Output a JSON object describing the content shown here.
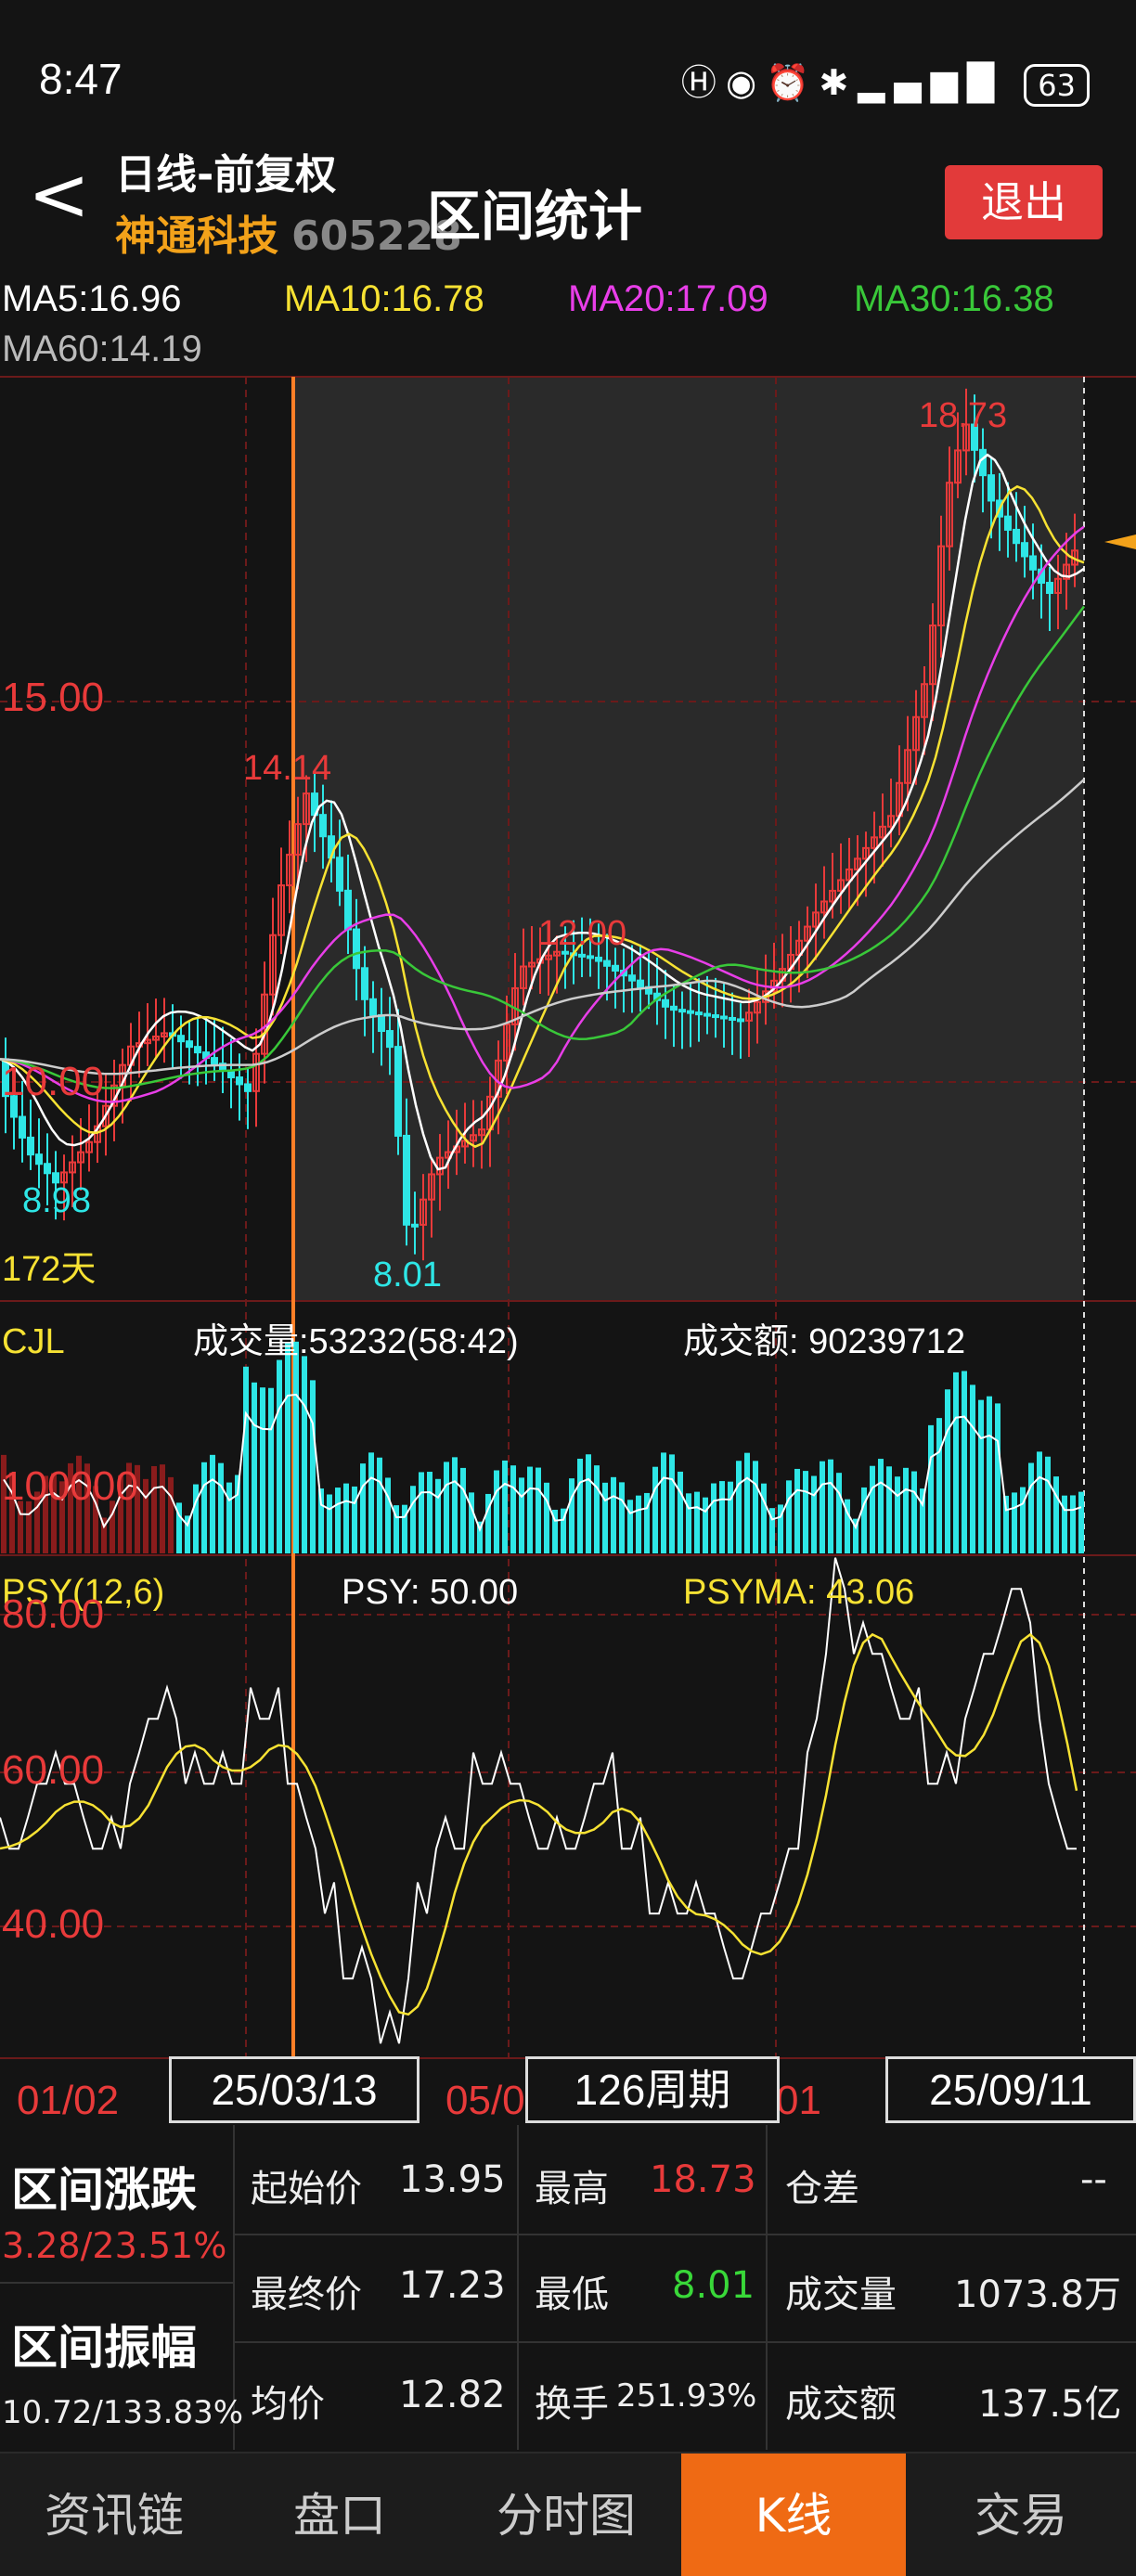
{
  "status_bar": {
    "time": "8:47",
    "icons": [
      "hd-icon",
      "eye-icon",
      "alarm-icon",
      "bluetooth-icon",
      "signal-icon"
    ],
    "battery": "63"
  },
  "header": {
    "period": "日线-前复权",
    "stock_name": "神通科技",
    "stock_code": "605228",
    "title": "区间统计",
    "exit_label": "退出"
  },
  "ma": {
    "ma5": "MA5:16.96",
    "ma10": "MA10:16.78",
    "ma20": "MA20:17.09",
    "ma30": "MA30:16.38",
    "ma60": "MA60:14.19"
  },
  "colors": {
    "ma5": "#ffffff",
    "ma10": "#f7e233",
    "ma20": "#e83ee8",
    "ma30": "#39c839",
    "ma60": "#cccccc",
    "up": "#e83a3a",
    "down": "#2ee6e6",
    "select": "#ff7f27"
  },
  "price_panel": {
    "level_15": "15.00",
    "level_10": "10.00",
    "high_label": "14.14",
    "low1_label": "8.98",
    "mid_label": "12.00",
    "low2_label": "8.01",
    "top_label": "18.73",
    "days_label": "172天"
  },
  "volume_panel": {
    "title": "CJL",
    "volume": "成交量:53232(58:42)",
    "amount": "成交额: 90239712",
    "level": "100000"
  },
  "psy_panel": {
    "title": "PSY(12,6)",
    "psy": "PSY: 50.00",
    "psyma": "PSYMA: 43.06",
    "level_80": "80.00",
    "level_60": "60.00",
    "level_40": "40.00"
  },
  "x_axis": {
    "label1": "01/02",
    "label2": "05/0",
    "label3": "01",
    "start_tag": "25/03/13",
    "period_tag": "126周期",
    "end_tag": "25/09/11"
  },
  "stats": {
    "range_change_label": "区间涨跌",
    "range_change_value": "3.28/23.51%",
    "range_amp_label": "区间振幅",
    "range_amp_value": "10.72/133.83%",
    "start_price_label": "起始价",
    "start_price": "13.95",
    "end_price_label": "最终价",
    "end_price": "17.23",
    "avg_price_label": "均价",
    "avg_price": "12.82",
    "high_label": "最高",
    "high": "18.73",
    "low_label": "最低",
    "low": "8.01",
    "turnover_label": "换手",
    "turnover": "251.93%",
    "pos_diff_label": "仓差",
    "pos_diff": "--",
    "volume_label": "成交量",
    "volume": "1073.8万",
    "amount_label": "成交额",
    "amount": "137.5亿"
  },
  "nav": [
    "资讯链",
    "盘口",
    "分时图",
    "K线",
    "交易"
  ],
  "nav_active": "K线"
}
